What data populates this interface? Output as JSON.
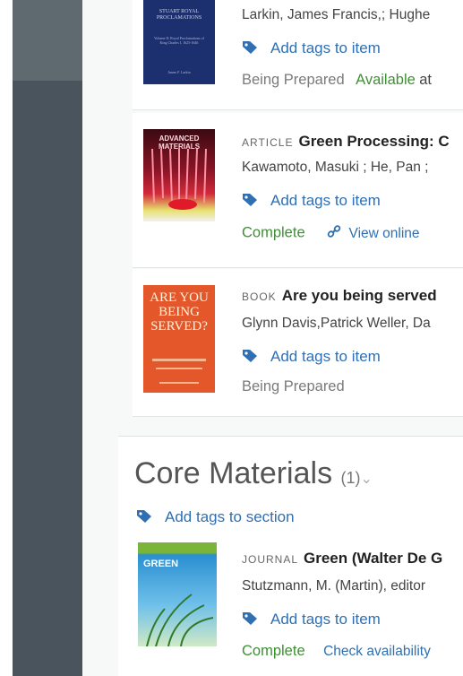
{
  "items": [
    {
      "cover_title": "STUART ROYAL PROCLAMATIONS",
      "cover_sub": "Volume II: Royal Proclamations of King Charles I, 1625-1646",
      "cover_author": "James F. Larkin",
      "authors": "Larkin, James Francis,; Hughe",
      "tag_label": "Add tags to item",
      "status": "Being Prepared",
      "availability": "Available",
      "availability_suffix": "at"
    },
    {
      "cover_title": "ADVANCED MATERIALS",
      "type": "ARTICLE",
      "title": "Green Processing: C",
      "authors": "Kawamoto, Masuki ; He, Pan ;",
      "tag_label": "Add tags to item",
      "status": "Complete",
      "link": "View online"
    },
    {
      "cover_title": "ARE YOU BEING SERVED?",
      "type": "BOOK",
      "title": "Are you being served",
      "authors": "Glynn Davis,Patrick Weller,  Da",
      "tag_label": "Add tags to item",
      "status": "Being Prepared"
    }
  ],
  "section": {
    "title": "Core Materials",
    "count": "(1)",
    "tag_label": "Add tags to section"
  },
  "core_item": {
    "cover_title": "GREEN",
    "type": "JOURNAL",
    "title": "Green (Walter De G",
    "authors": "Stutzmann, M. (Martin), editor",
    "tag_label": "Add tags to item",
    "status": "Complete",
    "link": "Check availability"
  },
  "colors": {
    "sidebar": "#4a545c",
    "link": "#2f6fb2",
    "complete": "#3f8f35"
  }
}
